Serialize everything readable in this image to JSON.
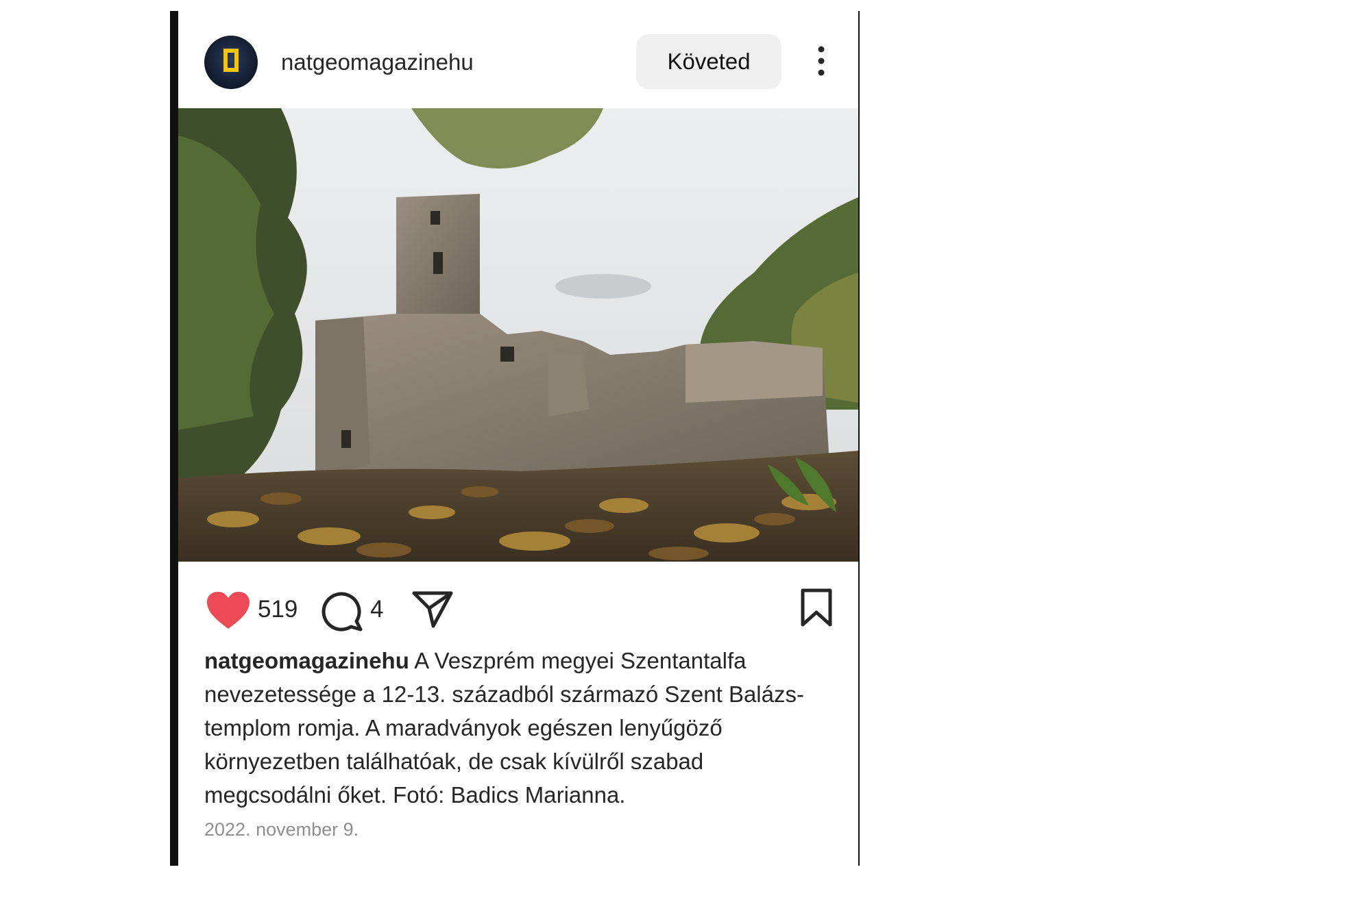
{
  "post": {
    "username": "natgeomagazinehu",
    "follow_label": "Követed",
    "likes_count": "519",
    "comments_count": "4",
    "caption_user": "natgeomagazinehu",
    "caption_text": "A Veszprém megyei Szentantalfa nevezetessége a 12-13. századból származó Szent Balázs-templom romja. A maradványok egészen lenyűgöző környezetben találhatóak, de csak kívülről szabad megcsodálni őket. Fotó: Badics Marianna.",
    "date": "2022. november 9.",
    "liked": true
  },
  "icons": {
    "avatar": "nat-geo-logo-icon",
    "more": "more-vertical-icon",
    "like": "heart-icon",
    "comment": "comment-bubble-icon",
    "share": "paper-plane-icon",
    "save": "bookmark-icon"
  },
  "colors": {
    "like": "#ed4956",
    "follow_bg": "#efefef",
    "text": "#262626",
    "muted": "#8e8e8e",
    "logo_yellow": "#f7c600"
  }
}
